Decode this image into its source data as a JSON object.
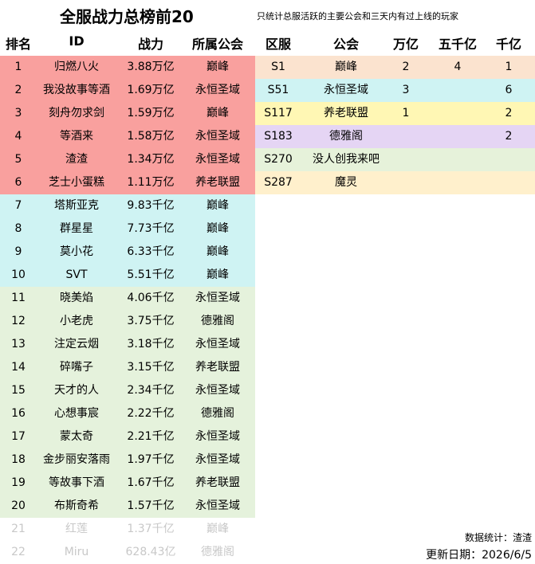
{
  "title": "全服战力总榜前20",
  "note": "只统计总服活跃的主要公会和三天内有过上线的玩家",
  "left_table": {
    "headers": [
      "排名",
      "ID",
      "战力",
      "所属公会"
    ],
    "rows": [
      {
        "rank": "1",
        "id": "归燃八火",
        "power": "3.88万亿",
        "guild": "巅峰",
        "band": "red"
      },
      {
        "rank": "2",
        "id": "我没故事等酒",
        "power": "1.69万亿",
        "guild": "永恒圣域",
        "band": "red"
      },
      {
        "rank": "3",
        "id": "刻舟勿求剑",
        "power": "1.59万亿",
        "guild": "巅峰",
        "band": "red"
      },
      {
        "rank": "4",
        "id": "等酒来",
        "power": "1.58万亿",
        "guild": "永恒圣域",
        "band": "red"
      },
      {
        "rank": "5",
        "id": "渣渣",
        "power": "1.34万亿",
        "guild": "永恒圣域",
        "band": "red"
      },
      {
        "rank": "6",
        "id": "芝士小蛋糕",
        "power": "1.11万亿",
        "guild": "养老联盟",
        "band": "red"
      },
      {
        "rank": "7",
        "id": "塔斯亚克",
        "power": "9.83千亿",
        "guild": "巅峰",
        "band": "cyan"
      },
      {
        "rank": "8",
        "id": "群星星",
        "power": "7.73千亿",
        "guild": "巅峰",
        "band": "cyan"
      },
      {
        "rank": "9",
        "id": "莫小花",
        "power": "6.33千亿",
        "guild": "巅峰",
        "band": "cyan"
      },
      {
        "rank": "10",
        "id": "SVT",
        "power": "5.51千亿",
        "guild": "巅峰",
        "band": "cyan"
      },
      {
        "rank": "11",
        "id": "晓美焰",
        "power": "4.06千亿",
        "guild": "永恒圣域",
        "band": "green"
      },
      {
        "rank": "12",
        "id": "小老虎",
        "power": "3.75千亿",
        "guild": "德雅阁",
        "band": "green"
      },
      {
        "rank": "13",
        "id": "注定云烟",
        "power": "3.18千亿",
        "guild": "永恒圣域",
        "band": "green"
      },
      {
        "rank": "14",
        "id": "碎嘴子",
        "power": "3.15千亿",
        "guild": "养老联盟",
        "band": "green"
      },
      {
        "rank": "15",
        "id": "天才的人",
        "power": "2.34千亿",
        "guild": "永恒圣域",
        "band": "green"
      },
      {
        "rank": "16",
        "id": "心想事宸",
        "power": "2.22千亿",
        "guild": "德雅阁",
        "band": "green"
      },
      {
        "rank": "17",
        "id": "蒙太奇",
        "power": "2.21千亿",
        "guild": "永恒圣域",
        "band": "green"
      },
      {
        "rank": "18",
        "id": "金步丽安落雨",
        "power": "1.97千亿",
        "guild": "永恒圣域",
        "band": "green"
      },
      {
        "rank": "19",
        "id": "等故事下酒",
        "power": "1.67千亿",
        "guild": "养老联盟",
        "band": "green"
      },
      {
        "rank": "20",
        "id": "布斯奇希",
        "power": "1.57千亿",
        "guild": "永恒圣域",
        "band": "green"
      },
      {
        "rank": "21",
        "id": "红莲",
        "power": "1.37千亿",
        "guild": "巅峰",
        "band": "faded"
      },
      {
        "rank": "22",
        "id": "Miru",
        "power": "628.43亿",
        "guild": "德雅阁",
        "band": "faded"
      }
    ]
  },
  "right_table": {
    "headers": [
      "区服",
      "公会",
      "万亿",
      "五千亿",
      "千亿"
    ],
    "rows": [
      {
        "server": "S1",
        "guild": "巅峰",
        "wanyi": "2",
        "wuqianyi": "4",
        "qianyi": "1",
        "band": "peach"
      },
      {
        "server": "S51",
        "guild": "永恒圣域",
        "wanyi": "3",
        "wuqianyi": "",
        "qianyi": "6",
        "band": "cyan"
      },
      {
        "server": "S117",
        "guild": "养老联盟",
        "wanyi": "1",
        "wuqianyi": "",
        "qianyi": "2",
        "band": "yellow"
      },
      {
        "server": "S183",
        "guild": "德雅阁",
        "wanyi": "",
        "wuqianyi": "",
        "qianyi": "2",
        "band": "purple"
      },
      {
        "server": "S270",
        "guild": "没人创我来吧",
        "wanyi": "",
        "wuqianyi": "",
        "qianyi": "",
        "band": "lgreen"
      },
      {
        "server": "S287",
        "guild": "魔灵",
        "wanyi": "",
        "wuqianyi": "",
        "qianyi": "",
        "band": "cream"
      }
    ]
  },
  "footer": {
    "stats": "数据统计：渣渣",
    "updated": "更新日期：2026/6/5"
  }
}
